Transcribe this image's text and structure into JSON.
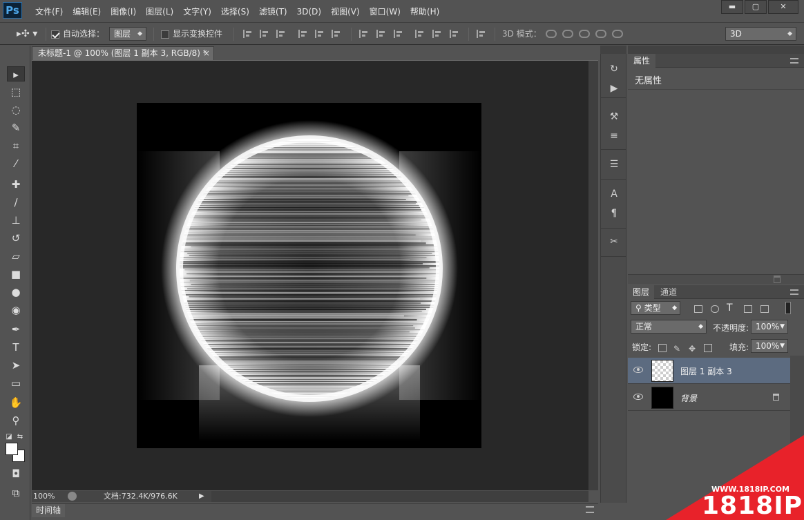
{
  "app": {
    "logo": "Ps"
  },
  "menu": [
    "文件(F)",
    "编辑(E)",
    "图像(I)",
    "图层(L)",
    "文字(Y)",
    "选择(S)",
    "滤镜(T)",
    "3D(D)",
    "视图(V)",
    "窗口(W)",
    "帮助(H)"
  ],
  "window_buttons": {
    "minimize": "▬",
    "maximize": "▢",
    "close": "✕"
  },
  "options": {
    "auto_select_label": "自动选择：",
    "auto_select_checked": true,
    "auto_select_value": "图层",
    "show_transform_label": "显示变换控件",
    "show_transform_checked": false,
    "mode_3d_label": "3D 模式：",
    "workspace_value": "3D"
  },
  "document": {
    "tab_title": "未标题-1 @ 100% (图层 1 副本 3, RGB/8) *",
    "tab_close": "×",
    "zoom": "100%",
    "doc_size": "文档:732.4K/976.6K",
    "status_arrow": "▶"
  },
  "timeline": {
    "label": "时间轴"
  },
  "properties": {
    "tab": "属性",
    "empty_text": "无属性"
  },
  "layers": {
    "tabs": [
      "图层",
      "通道"
    ],
    "filter_kind": "类型",
    "blend_mode": "正常",
    "opacity_label": "不透明度:",
    "opacity_value": "100%",
    "lock_label": "锁定:",
    "fill_label": "填充:",
    "fill_value": "100%",
    "items": [
      {
        "name": "图层 1 副本 3",
        "selected": true,
        "visible": true,
        "locked": false
      },
      {
        "name": "背景",
        "selected": false,
        "visible": true,
        "locked": true
      }
    ]
  },
  "tools": [
    "move-tool",
    "marquee-tool",
    "lasso-tool",
    "quick-select-tool",
    "crop-tool",
    "eyedropper-tool",
    "healing-brush-tool",
    "brush-tool",
    "clone-stamp-tool",
    "history-brush-tool",
    "eraser-tool",
    "gradient-tool",
    "blur-tool",
    "dodge-tool",
    "pen-tool",
    "type-tool",
    "path-select-tool",
    "rectangle-tool",
    "hand-tool",
    "zoom-tool"
  ],
  "colors": {
    "foreground": "#ffffff",
    "background": "#ffffff",
    "selected_layer": "#5c6b80"
  },
  "watermark": {
    "url": "WWW.1818IP.COM",
    "brand": "1818IP"
  }
}
